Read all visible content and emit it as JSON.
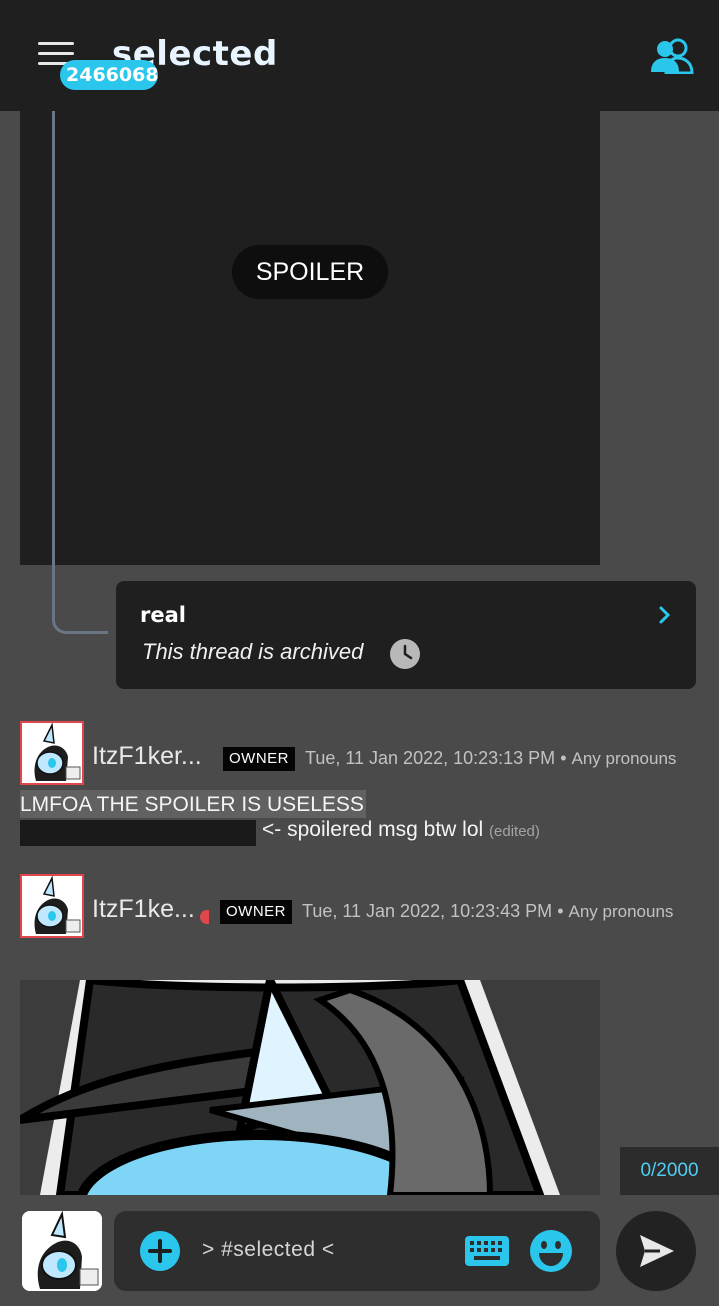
{
  "header": {
    "title": "selected",
    "badge": "2466068"
  },
  "spoiler": {
    "label": "SPOILER"
  },
  "thread": {
    "name": "real",
    "status": "This thread is archived"
  },
  "messages": [
    {
      "author": "ItzF1ker...",
      "role": "OWNER",
      "timestamp": "Tue, 11 Jan 2022, 10:23:13 PM",
      "separator": "•",
      "pronouns": "Any pronouns",
      "line1": "LMFOA THE SPOILER IS USELESS",
      "line2": "<- spoilered msg btw lol",
      "edited": "(edited)"
    },
    {
      "author": "ItzF1ke...",
      "role": "OWNER",
      "timestamp": "Tue, 11 Jan 2022, 10:23:43 PM",
      "separator": "•",
      "pronouns": "Any pronouns"
    }
  ],
  "composer": {
    "placeholder": ">  #selected  <",
    "counter": "0/2000"
  },
  "colors": {
    "accent": "#2bc6ec",
    "header_bg": "#1f1f1f",
    "page_bg": "#4a4a4a",
    "avatar_border": "#e0474c"
  },
  "icons": [
    "menu-icon",
    "users-icon",
    "clock-icon",
    "chevron-right-icon",
    "plus-icon",
    "keyboard-icon",
    "emoji-icon",
    "send-icon"
  ]
}
